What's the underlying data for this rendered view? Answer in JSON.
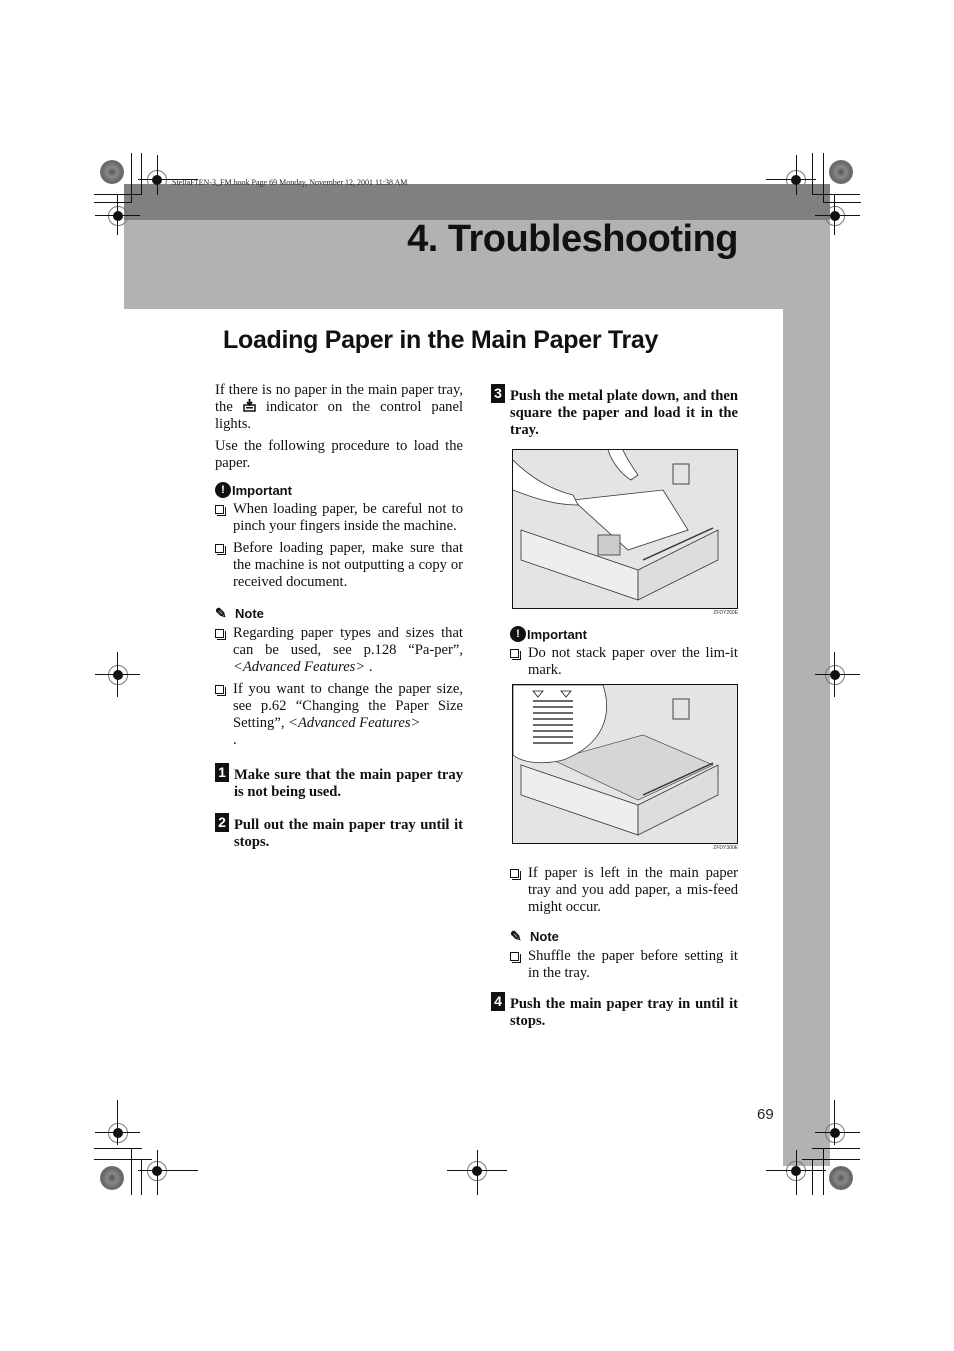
{
  "header": {
    "file_info": "StellaF1EN-3_FM.book  Page 69  Monday, November 12, 2001  11:38 AM",
    "chapter_title": "4. Troubleshooting"
  },
  "section_title": "Loading Paper in the Main Paper Tray",
  "left_column": {
    "intro": [
      {
        "before": "If there is no paper in the main paper tray, the ",
        "icon": "paper-tray-indicator-icon",
        "after": " indicator on the control panel lights."
      },
      {
        "text": "Use the following procedure to load the paper."
      }
    ],
    "important": {
      "label": "Important",
      "items": [
        "When loading paper, be careful not to pinch your fingers inside the machine.",
        "Before loading paper, make sure that the machine is not outputting a copy or received document."
      ]
    },
    "note": {
      "label": "Note",
      "items": [
        {
          "text": "Regarding paper types and sizes that can be used, see p.128 “Pa-per”, ",
          "italic": "<Advanced Features>",
          "after": " ."
        },
        {
          "text": "If you want to change the paper size, see p.62 “Changing the Paper Size Setting”, ",
          "italic": "<Advanced Features>",
          "after": " ."
        }
      ]
    },
    "steps": [
      {
        "number": "1",
        "text": "Make sure that the main paper tray is not being used."
      },
      {
        "number": "2",
        "text": "Pull out the main paper tray until it stops."
      }
    ]
  },
  "right_column": {
    "step3": {
      "number": "3",
      "text": "Push the metal plate down, and then square the paper and load it in the tray."
    },
    "figure1": {
      "caption": "ZFDY260E",
      "description": "Hands loading a stack of paper into the pulled-out paper tray"
    },
    "important": {
      "label": "Important",
      "items": [
        "Do not stack paper over the lim-it mark."
      ]
    },
    "figure2": {
      "caption": "ZFDY300E",
      "description": "Paper tray with callout showing the paper limit mark"
    },
    "bullet_after_figure": "If paper is left in the main paper tray and you add paper, a mis-feed might occur.",
    "note": {
      "label": "Note",
      "items": [
        "Shuffle the paper before setting it in the tray."
      ]
    },
    "step4": {
      "number": "4",
      "text": "Push the main paper tray in until it stops."
    }
  },
  "footer": {
    "page_number": "69"
  }
}
